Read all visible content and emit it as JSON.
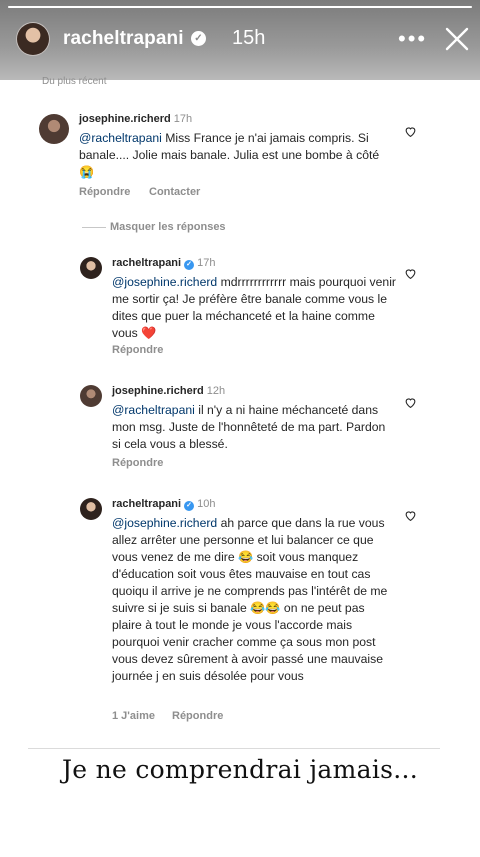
{
  "story": {
    "username": "racheltrapani",
    "time": "15h",
    "progress": 1.0,
    "more_icon": "more-horizontal-icon",
    "close_icon": "close-icon"
  },
  "screenshot": {
    "sort_label": "Du plus récent",
    "hide_replies": "Masquer les réponses",
    "comments": [
      {
        "user": "josephine.richerd",
        "time": "17h",
        "mention": "@racheltrapani",
        "text": " Miss France je n'ai jamais compris. Si banale.... Jolie mais banale. Julia est une bombe à côté 😭",
        "reply_label": "Répondre",
        "contact_label": "Contacter"
      },
      {
        "user": "racheltrapani",
        "time": "17h",
        "mention": "@josephine.richerd",
        "text": " mdrrrrrrrrrrrr mais pourquoi venir me sortir ça! Je préfère être banale comme vous le dites que puer la méchanceté et la haine comme vous ❤️",
        "reply_label": "Répondre"
      },
      {
        "user": "josephine.richerd",
        "time": "12h",
        "mention": "@racheltrapani",
        "text": " il n'y a ni haine méchanceté dans mon msg. Juste de l'honnêteté de ma part. Pardon si cela vous a blessé.",
        "reply_label": "Répondre"
      },
      {
        "user": "racheltrapani",
        "time": "10h",
        "mention": "@josephine.richerd",
        "text": " ah parce que dans la rue vous allez arrêter une personne et lui balancer ce que vous venez de me dire 😂 soit vous manquez d'éducation soit vous êtes mauvaise en tout cas quoiqu il arrive je ne comprends pas l'intérêt de me suivre si je suis si banale 😂😂 on ne peut pas plaire à tout le monde je vous l'accorde mais pourquoi venir cracher comme ça sous mon post vous devez sûrement à avoir passé une mauvaise journée j en suis désolée pour vous",
        "likes_label": "1 J'aime",
        "reply_label": "Répondre"
      }
    ]
  },
  "caption": "Je ne comprendrai jamais...",
  "colors": {
    "mention": "#00376b",
    "verified": "#3897f0",
    "muted": "#8e8e8e"
  }
}
